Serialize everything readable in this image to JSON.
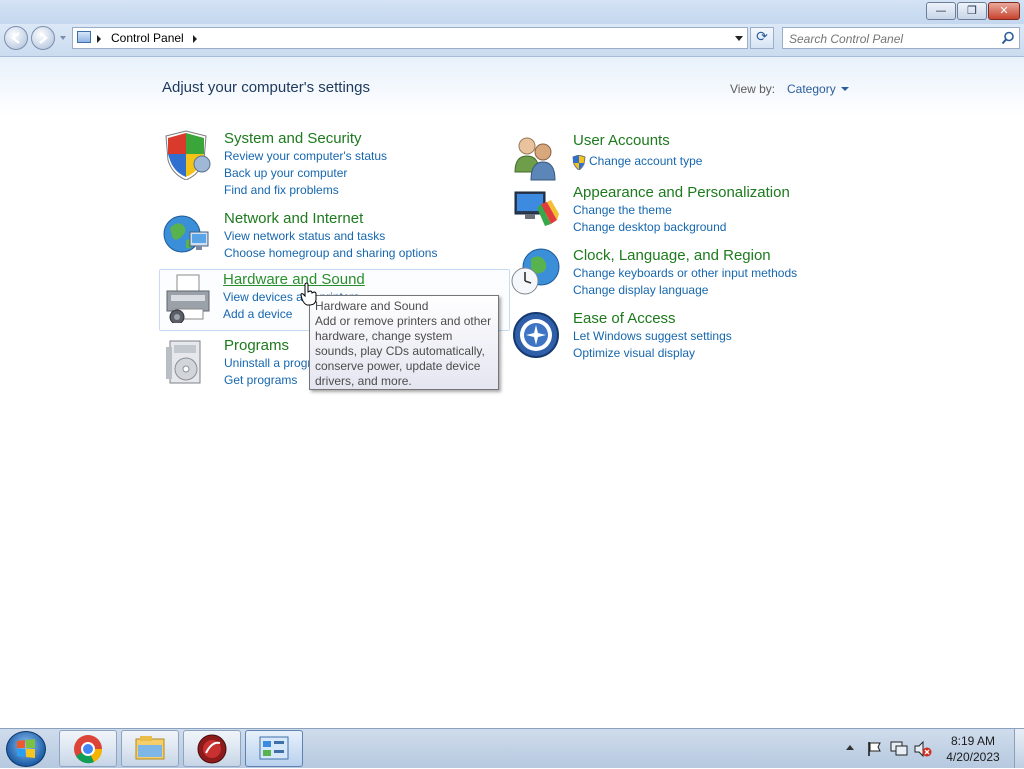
{
  "window": {
    "minimize_label": "—",
    "restore_label": "❐",
    "close_label": "✕"
  },
  "navbar": {
    "breadcrumb": "Control Panel",
    "refresh_label": "⟳",
    "search_placeholder": "Search Control Panel"
  },
  "main": {
    "heading": "Adjust your computer's settings",
    "view_by_label": "View by:",
    "view_by_value": "Category",
    "categories": [
      {
        "title": "System and Security",
        "icon": "shield-icon",
        "links": [
          "Review your computer's status",
          "Back up your computer",
          "Find and fix problems"
        ]
      },
      {
        "title": "Network and Internet",
        "icon": "network-globe-icon",
        "links": [
          "View network status and tasks",
          "Choose homegroup and sharing options"
        ]
      },
      {
        "title": "Hardware and Sound",
        "icon": "printer-icon",
        "links": [
          "View devices and printers",
          "Add a device"
        ]
      },
      {
        "title": "Programs",
        "icon": "programs-icon",
        "links": [
          "Uninstall a program",
          "Get programs"
        ]
      },
      {
        "title": "User Accounts",
        "icon": "users-icon",
        "links": [
          "Change account type"
        ]
      },
      {
        "title": "Appearance and Personalization",
        "icon": "monitor-paint-icon",
        "links": [
          "Change the theme",
          "Change desktop background"
        ]
      },
      {
        "title": "Clock, Language, and Region",
        "icon": "globe-clock-icon",
        "links": [
          "Change keyboards or other input methods",
          "Change display language"
        ]
      },
      {
        "title": "Ease of Access",
        "icon": "ease-of-access-icon",
        "links": [
          "Let Windows suggest settings",
          "Optimize visual display"
        ]
      }
    ]
  },
  "tooltip": {
    "title": "Hardware and Sound",
    "body": "Add or remove printers and other hardware, change system sounds, play CDs automatically, conserve power, update device drivers, and more."
  },
  "taskbar": {
    "pinned": [
      "chrome-icon",
      "explorer-icon",
      "media-icon",
      "control-panel-icon"
    ],
    "time": "8:19 AM",
    "date": "4/20/2023"
  },
  "colors": {
    "category_title": "#1d7a1d",
    "link": "#1667ae",
    "heading": "#1e395b"
  }
}
